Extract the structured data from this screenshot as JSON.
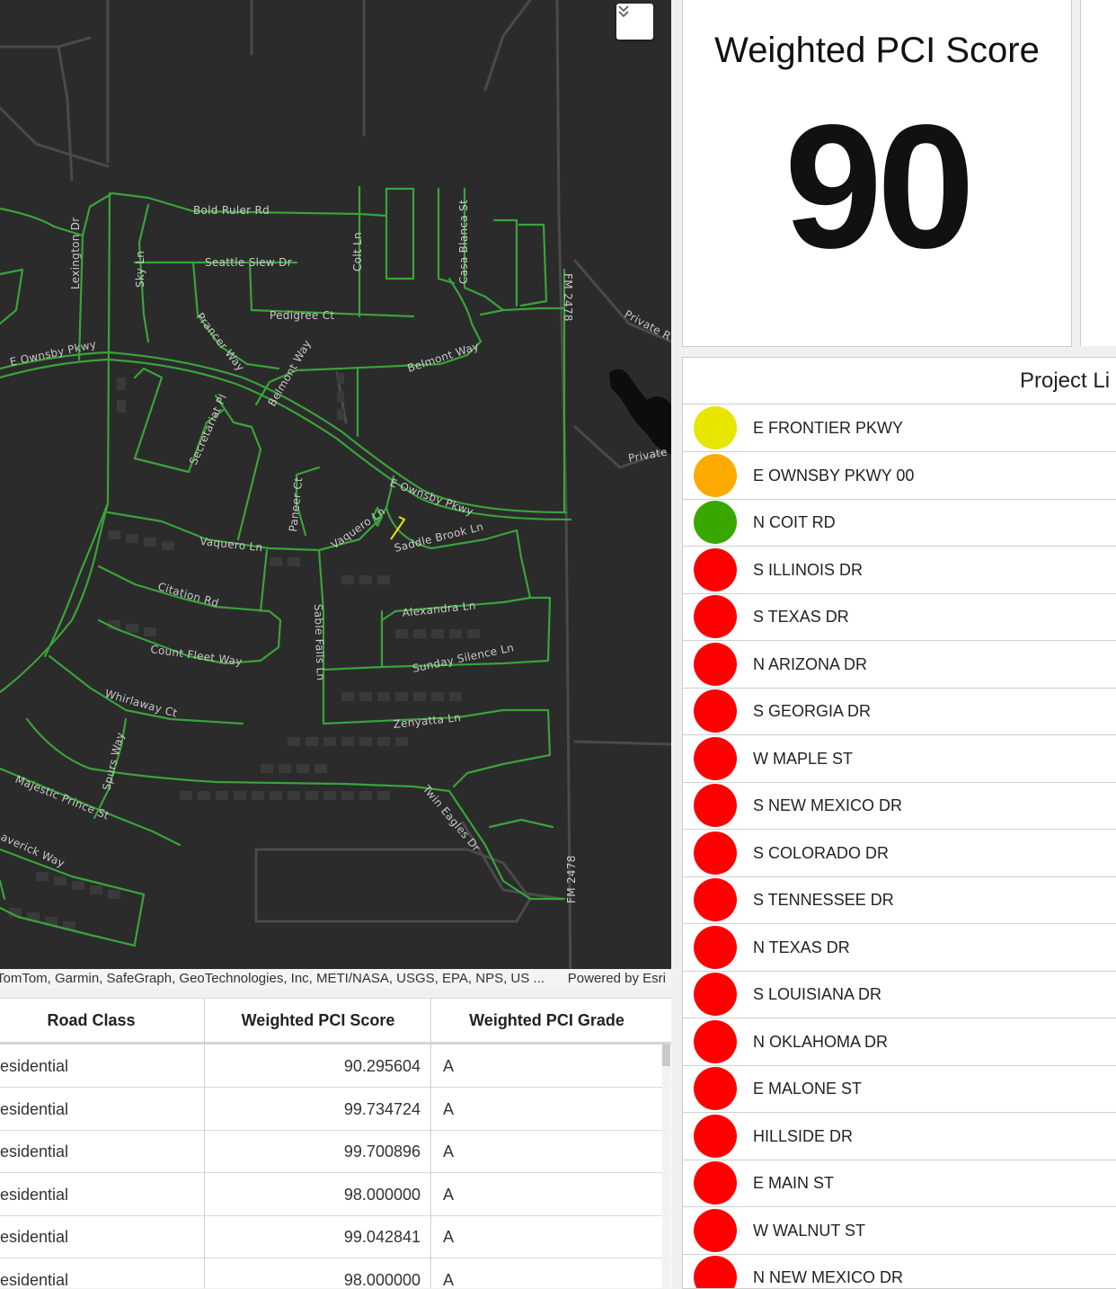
{
  "map": {
    "attribution": "TomTom, Garmin, SafeGraph, GeoTechnologies, Inc, METI/NASA, USGS, EPA, NPS, US ...",
    "powered_by": "Powered by Esri",
    "labels": {
      "bold_ruler": "Bold Ruler Rd",
      "seattle_slew": "Seattle Slew Dr",
      "pedigree": "Pedigree Ct",
      "colt": "Colt Ln",
      "casa_blanca": "Casa Blanca St",
      "lexington": "Lexington Dr",
      "sky": "Sky Ln",
      "prancer": "Prancer Way",
      "belmont_way": "Belmont Way",
      "belmont_way_2": "Belmont Way",
      "e_ownsby_left": "E Ownsby Pkwy",
      "e_ownsby_right": "E Ownsby Pkwy",
      "fm_top": "FM 2478",
      "fm_bottom": "FM 2478",
      "private_top": "Private R",
      "private_mid": "Private",
      "secretariat": "Secretariat Pl",
      "paneer": "Paneer Ct",
      "vaquero": "Vaquero Ln",
      "vaquero_2": "Vaquero Ln",
      "saddle_brook": "Saddle Brook Ln",
      "citation": "Citation Rd",
      "alexandra": "Alexandra Ln",
      "sable_falls": "Sable Falls Ln",
      "count_fleet": "Count Fleet Way",
      "sunday_silence": "Sunday Silence Ln",
      "whirlaway": "Whirlaway Ct",
      "zenyatta": "Zenyatta Ln",
      "spurs": "Spurs Way",
      "majestic_prince": "Majestic Prince St",
      "twin_eagles": "Twin Eagles Dr",
      "maverick": "averick Way"
    }
  },
  "table": {
    "headers": [
      "Road Class",
      "Weighted PCI Score",
      "Weighted PCI Grade"
    ],
    "rows": [
      [
        "esidential",
        "90.295604",
        "A"
      ],
      [
        "esidential",
        "99.734724",
        "A"
      ],
      [
        "esidential",
        "99.700896",
        "A"
      ],
      [
        "esidential",
        "98.000000",
        "A"
      ],
      [
        "esidential",
        "99.042841",
        "A"
      ],
      [
        "esidential",
        "98.000000",
        "A"
      ]
    ]
  },
  "score_panel": {
    "title": "Weighted PCI Score",
    "value": "90"
  },
  "project_list": {
    "title": "Project Li",
    "colors": {
      "yellow": "#e6e600",
      "orange": "#ffaa00",
      "green": "#38a800",
      "red": "#ff0000"
    },
    "items": [
      {
        "name": "E FRONTIER PKWY",
        "status": "yellow"
      },
      {
        "name": "E OWNSBY PKWY 00",
        "status": "orange"
      },
      {
        "name": "N COIT RD",
        "status": "green"
      },
      {
        "name": "S ILLINOIS DR",
        "status": "red"
      },
      {
        "name": "S TEXAS DR",
        "status": "red"
      },
      {
        "name": "N ARIZONA DR",
        "status": "red"
      },
      {
        "name": "S GEORGIA DR",
        "status": "red"
      },
      {
        "name": "W MAPLE ST",
        "status": "red"
      },
      {
        "name": "S NEW MEXICO DR",
        "status": "red"
      },
      {
        "name": "S COLORADO DR",
        "status": "red"
      },
      {
        "name": "S TENNESSEE DR",
        "status": "red"
      },
      {
        "name": "N TEXAS DR",
        "status": "red"
      },
      {
        "name": "S LOUISIANA DR",
        "status": "red"
      },
      {
        "name": "N OKLAHOMA DR",
        "status": "red"
      },
      {
        "name": "E MALONE ST",
        "status": "red"
      },
      {
        "name": "HILLSIDE DR",
        "status": "red"
      },
      {
        "name": "E MAIN ST",
        "status": "red"
      },
      {
        "name": "W WALNUT ST",
        "status": "red"
      },
      {
        "name": "N NEW MEXICO DR",
        "status": "red"
      }
    ]
  }
}
